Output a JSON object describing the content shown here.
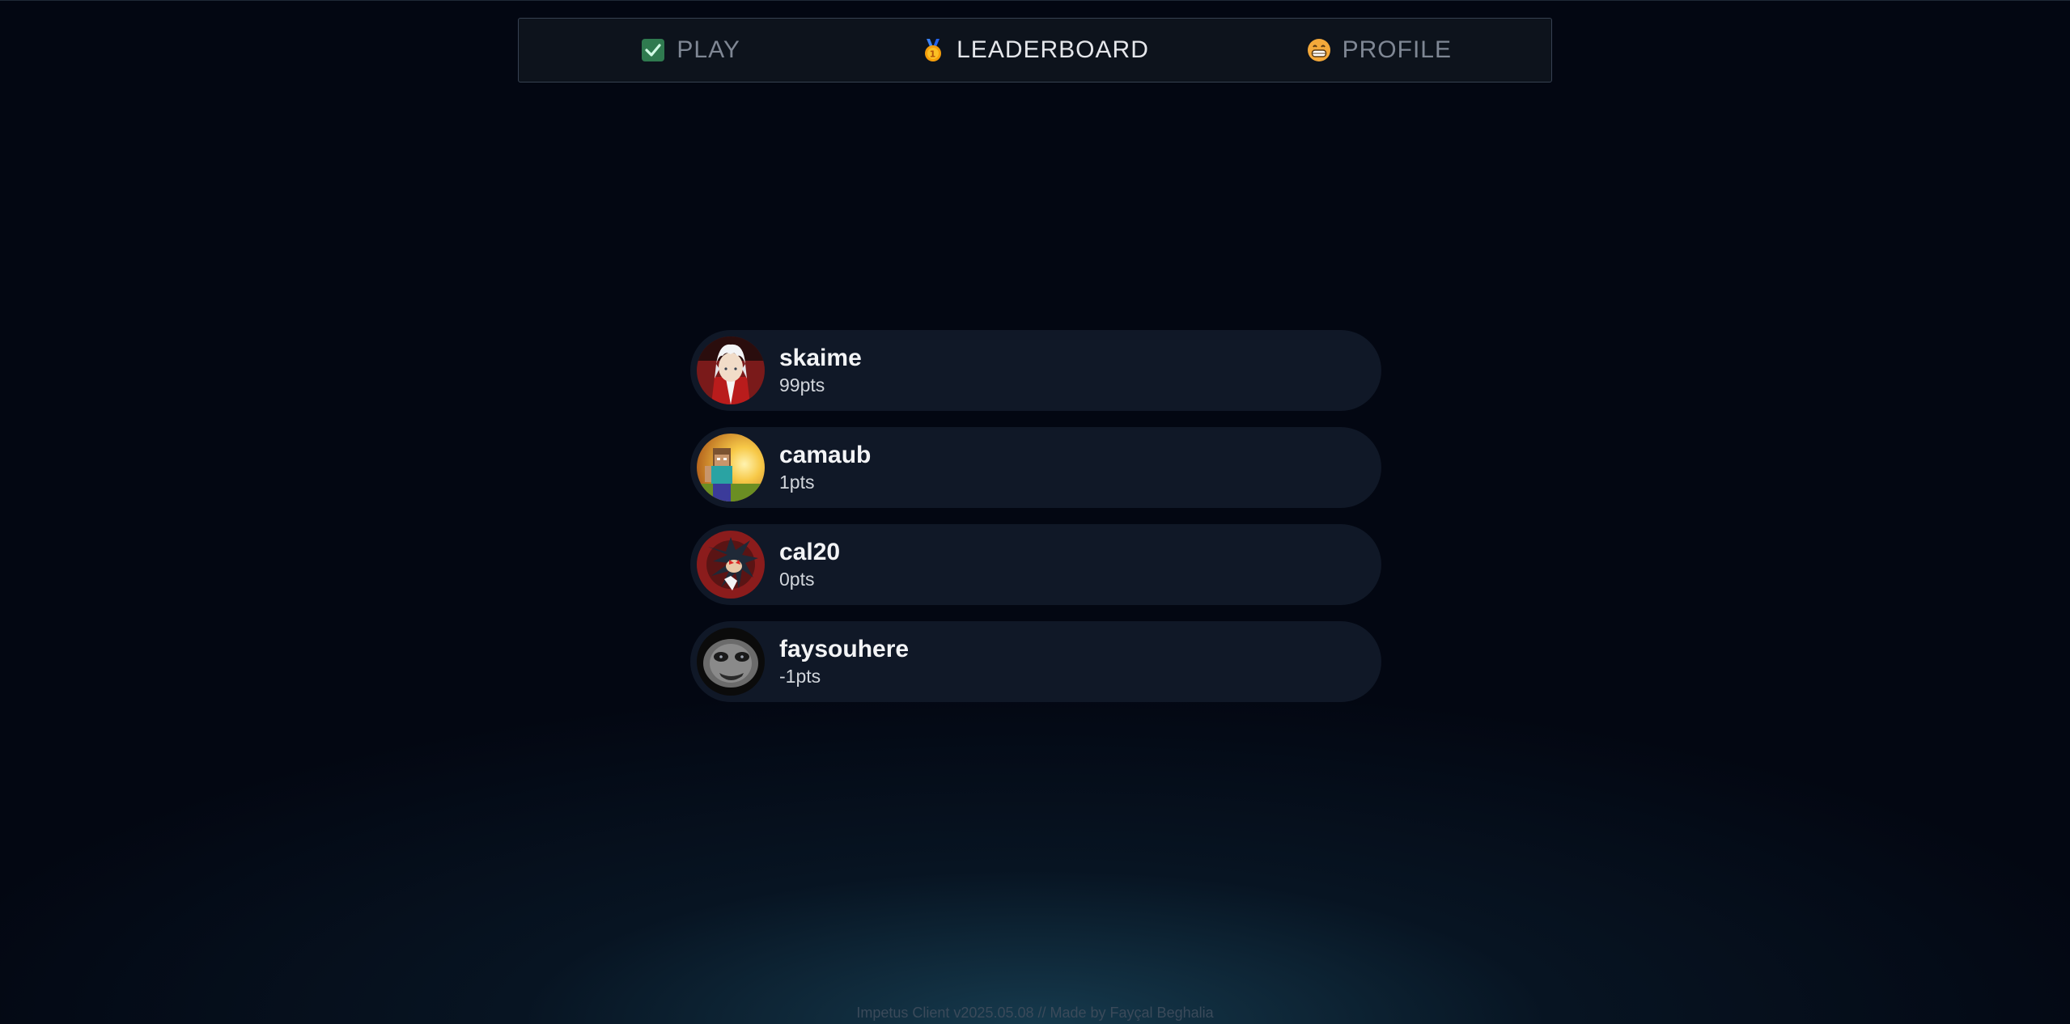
{
  "nav": {
    "tabs": [
      {
        "label": "PLAY",
        "icon": "check-icon",
        "active": false
      },
      {
        "label": "LEADERBOARD",
        "icon": "medal-icon",
        "active": true
      },
      {
        "label": "PROFILE",
        "icon": "grin-face-icon",
        "active": false
      }
    ]
  },
  "leaderboard": {
    "entries": [
      {
        "username": "skaime",
        "points": "99pts",
        "avatar": "avatar-white-hair-red-coat"
      },
      {
        "username": "camaub",
        "points": "1pts",
        "avatar": "avatar-blocky-character-sunset"
      },
      {
        "username": "cal20",
        "points": "0pts",
        "avatar": "avatar-dark-hedgehog"
      },
      {
        "username": "faysouhere",
        "points": "-1pts",
        "avatar": "avatar-grey-face"
      }
    ]
  },
  "footer": {
    "text": "Impetus Client v2025.05.08 // Made by Fayçal Beghalia"
  },
  "colors": {
    "background": "#030712",
    "card": "#101827",
    "nav_border": "#374151",
    "check_green": "#2f7a4f",
    "medal_gold": "#f59e0b",
    "medal_ribbon": "#3b82f6"
  }
}
